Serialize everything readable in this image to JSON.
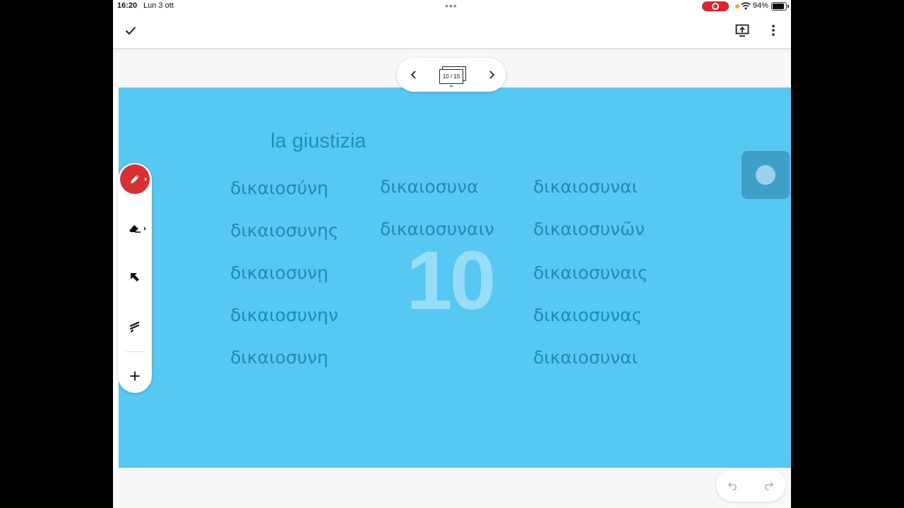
{
  "status_bar": {
    "time": "16:20",
    "date": "Lun 3 ott",
    "battery": "94%"
  },
  "app_bar": {
    "done_icon": "checkmark-icon",
    "present_icon": "present-screen-icon",
    "more_icon": "more-vertical-icon"
  },
  "page_nav": {
    "indicator": "10 / 15"
  },
  "slide": {
    "title": "la giustizia",
    "page_watermark": "10",
    "background": "#56c8f2",
    "text_color": "#1e8cb4",
    "column1": [
      "δικαιοσύνη",
      "δικαιοσυνης",
      "δικαιοσυνῃ",
      "δικαιοσυνην",
      "δικαιοσυνη"
    ],
    "column2": [
      "δικαιοσυνα",
      "δικαιοσυναιν"
    ],
    "column3": [
      "δικαιοσυναι",
      "δικαιοσυνῶν",
      "δικαιοσυναις",
      "δικαιοσυνας",
      "δικαιοσυναι"
    ]
  },
  "tools": {
    "pen": "pen-icon",
    "eraser": "eraser-icon",
    "pointer": "pointer-arrow-icon",
    "laser": "laser-icon",
    "add": "plus-icon",
    "accent": "#d93033"
  }
}
